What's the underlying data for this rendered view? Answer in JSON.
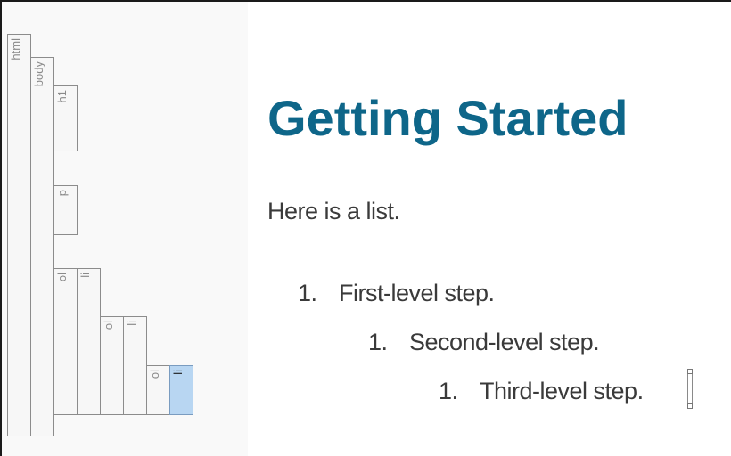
{
  "structure_bar": {
    "tags": {
      "html": "html",
      "body": "body",
      "h1": "h1",
      "p": "p",
      "ol1": "ol",
      "li1": "li",
      "ol2": "ol",
      "li2": "li",
      "ol3": "ol",
      "li3": "li"
    },
    "selected": "li3"
  },
  "document": {
    "heading": "Getting Started",
    "paragraph": "Here is a list.",
    "list": [
      {
        "number": "1.",
        "text": "First-level step."
      },
      {
        "number": "1.",
        "text": "Second-level step."
      },
      {
        "number": "1.",
        "text": "Third-level step."
      }
    ]
  },
  "colors": {
    "heading": "#0e6689",
    "body_text": "#3a3a3a",
    "selected_tag": "#b8d6f2"
  }
}
